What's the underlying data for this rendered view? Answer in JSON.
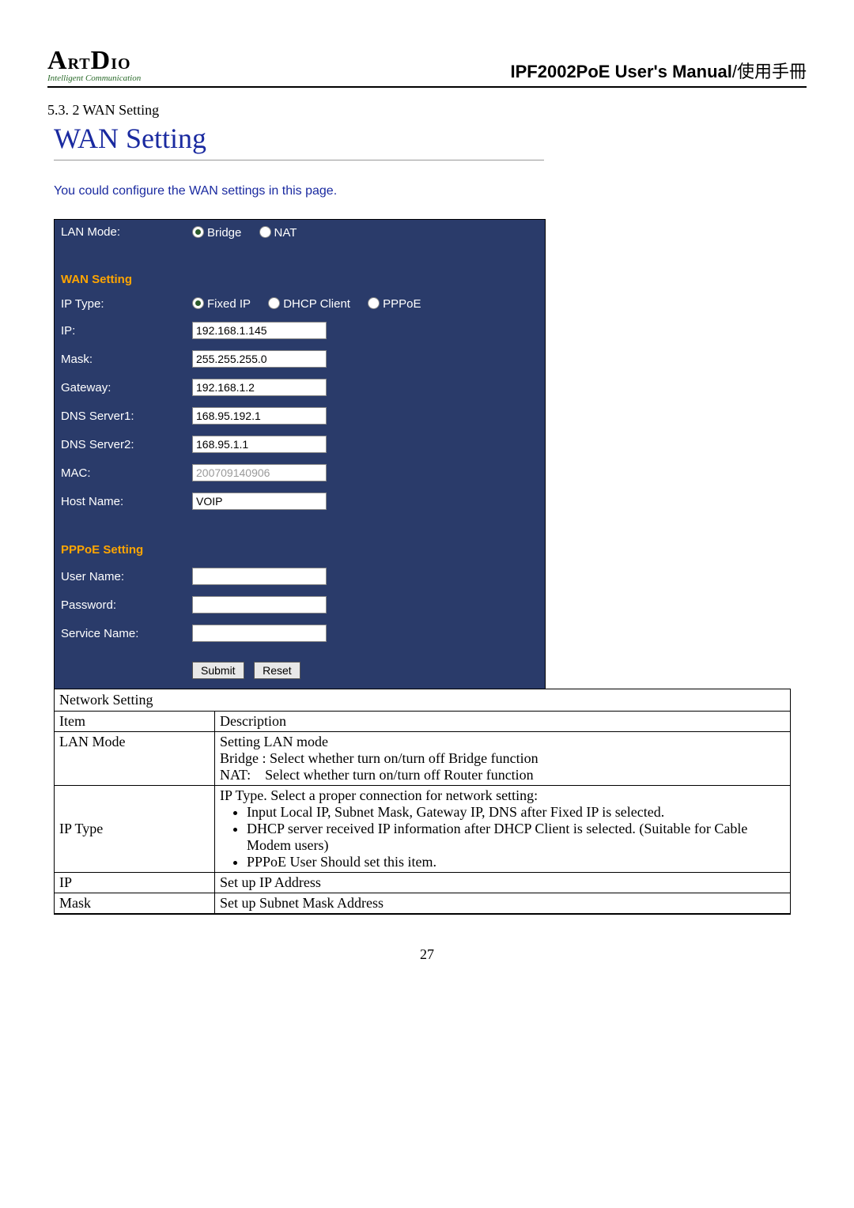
{
  "header": {
    "logo_main": "ArtDio",
    "logo_sub": "Intelligent Communication",
    "doc_title_bold": "IPF2002PoE User's Manual",
    "doc_title_tail": "/使用手冊"
  },
  "section": {
    "number_label": "5.3. 2 WAN Setting",
    "heading": "WAN Setting",
    "intro": "You could configure the WAN settings in this page."
  },
  "form": {
    "lan_mode_label": "LAN Mode:",
    "lan_mode_options": {
      "bridge": "Bridge",
      "nat": "NAT"
    },
    "wan_setting_header": "WAN Setting",
    "ip_type_label": "IP Type:",
    "ip_type_options": {
      "fixed": "Fixed IP",
      "dhcp": "DHCP Client",
      "pppoe": "PPPoE"
    },
    "ip_label": "IP:",
    "ip_value": "192.168.1.145",
    "mask_label": "Mask:",
    "mask_value": "255.255.255.0",
    "gateway_label": "Gateway:",
    "gateway_value": "192.168.1.2",
    "dns1_label": "DNS Server1:",
    "dns1_value": "168.95.192.1",
    "dns2_label": "DNS Server2:",
    "dns2_value": "168.95.1.1",
    "mac_label": "MAC:",
    "mac_value": "200709140906",
    "host_label": "Host Name:",
    "host_value": "VOIP",
    "pppoe_header": "PPPoE Setting",
    "user_label": "User Name:",
    "user_value": "",
    "pass_label": "Password:",
    "pass_value": "",
    "service_label": "Service Name:",
    "service_value": "",
    "submit_label": "Submit",
    "reset_label": "Reset"
  },
  "desc_table": {
    "caption": "Network Setting",
    "head_item": "Item",
    "head_desc": "Description",
    "rows": {
      "lan_mode_item": "LAN Mode",
      "lan_mode_l1": "Setting LAN mode",
      "lan_mode_l2": "Bridge : Select whether turn on/turn off Bridge function",
      "lan_mode_l3": "NAT:    Select whether turn on/turn off Router function",
      "ip_type_item": "IP Type",
      "ip_type_l1": "IP Type. Select a proper connection for network setting:",
      "ip_type_b1": "Input Local IP, Subnet Mask, Gateway IP, DNS after Fixed IP is selected.",
      "ip_type_b2": "DHCP server received IP information after DHCP Client is selected. (Suitable for Cable Modem users)",
      "ip_type_b3": "PPPoE User Should set this item.",
      "ip_item": "IP",
      "ip_desc": "Set up IP Address",
      "mask_item": "Mask",
      "mask_desc": "Set up Subnet Mask Address"
    }
  },
  "page_number": "27"
}
